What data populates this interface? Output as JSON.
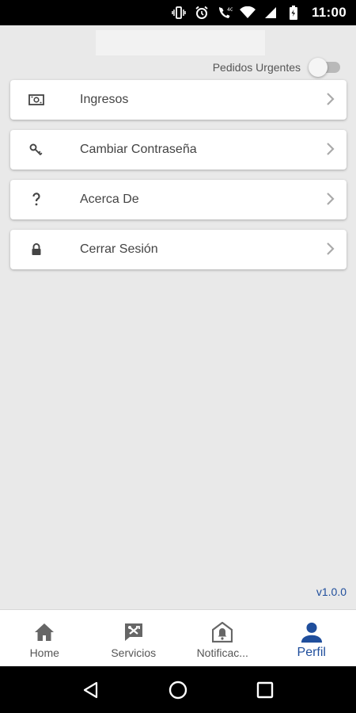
{
  "status_bar": {
    "time": "11:00",
    "icons": [
      "vibrate-icon",
      "alarm-icon",
      "wifi-calling-icon",
      "wifi-icon",
      "signal-icon",
      "battery-icon"
    ]
  },
  "header": {
    "urgent_orders_label": "Pedidos Urgentes",
    "urgent_orders_enabled": false
  },
  "menu": {
    "items": [
      {
        "icon": "money-icon",
        "label": "Ingresos"
      },
      {
        "icon": "key-icon",
        "label": "Cambiar Contraseña"
      },
      {
        "icon": "question-icon",
        "label": "Acerca De"
      },
      {
        "icon": "lock-icon",
        "label": "Cerrar Sesión"
      }
    ]
  },
  "version": "v1.0.0",
  "bottom_nav": {
    "items": [
      {
        "icon": "home-icon",
        "label": "Home",
        "active": false
      },
      {
        "icon": "services-icon",
        "label": "Servicios",
        "active": false
      },
      {
        "icon": "notifications-icon",
        "label": "Notificac...",
        "active": false
      },
      {
        "icon": "person-icon",
        "label": "Perfil",
        "active": true
      }
    ]
  },
  "colors": {
    "accent": "#1f4e9c",
    "background": "#e9e9e9",
    "icon_inactive": "#666666"
  }
}
